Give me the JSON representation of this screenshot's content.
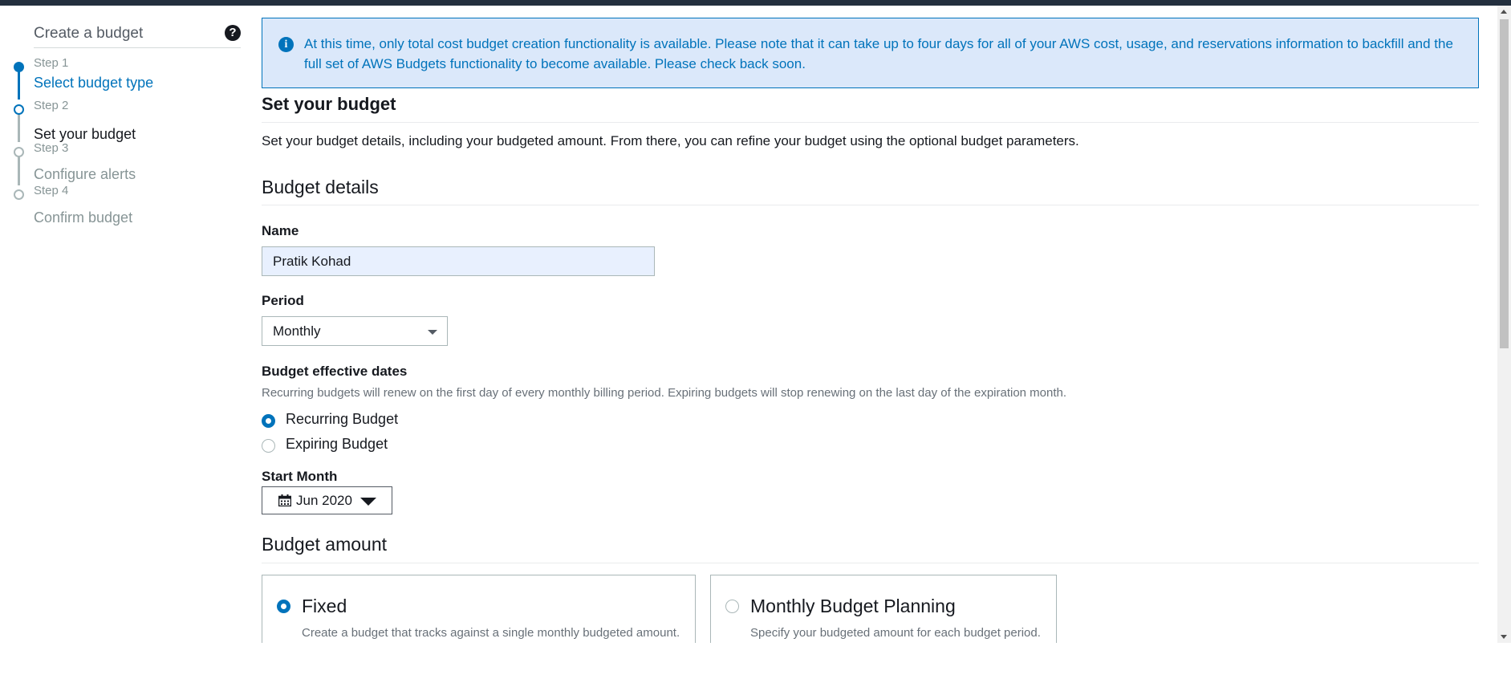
{
  "sidebar": {
    "title": "Create a budget",
    "help_icon": "question-circle-icon",
    "steps": [
      {
        "number": "Step 1",
        "label": "Select budget type",
        "state": "completed"
      },
      {
        "number": "Step 2",
        "label": "Set your budget",
        "state": "current"
      },
      {
        "number": "Step 3",
        "label": "Configure alerts",
        "state": "upcoming"
      },
      {
        "number": "Step 4",
        "label": "Confirm budget",
        "state": "upcoming"
      }
    ]
  },
  "alert": {
    "icon": "info-circle-icon",
    "text": "At this time, only total cost budget creation functionality is available. Please note that it can take up to four days for all of your AWS cost, usage, and reservations information to backfill and the full set of AWS Budgets functionality to become available. Please check back soon."
  },
  "page": {
    "title": "Set your budget",
    "description": "Set your budget details, including your budgeted amount. From there, you can refine your budget using the optional budget parameters."
  },
  "budget_details": {
    "heading": "Budget details",
    "name": {
      "label": "Name",
      "value": "Pratik Kohad"
    },
    "period": {
      "label": "Period",
      "value": "Monthly"
    },
    "effective_dates": {
      "label": "Budget effective dates",
      "hint": "Recurring budgets will renew on the first day of every monthly billing period. Expiring budgets will stop renewing on the last day of the expiration month.",
      "options": [
        {
          "label": "Recurring Budget",
          "selected": true
        },
        {
          "label": "Expiring Budget",
          "selected": false
        }
      ]
    },
    "start_month": {
      "label": "Start Month",
      "value": "Jun 2020",
      "icon": "calendar-icon"
    }
  },
  "budget_amount": {
    "heading": "Budget amount",
    "options": [
      {
        "title": "Fixed",
        "description": "Create a budget that tracks against a single monthly budgeted amount.",
        "selected": true
      },
      {
        "title": "Monthly Budget Planning",
        "description": "Specify your budgeted amount for each budget period.",
        "selected": false
      }
    ]
  },
  "colors": {
    "accent": "#0073bb",
    "alert_background": "#dbe8fa",
    "top_bar": "#232f3e",
    "step_active": "#0073bb",
    "step_inactive": "#aab7b8"
  }
}
